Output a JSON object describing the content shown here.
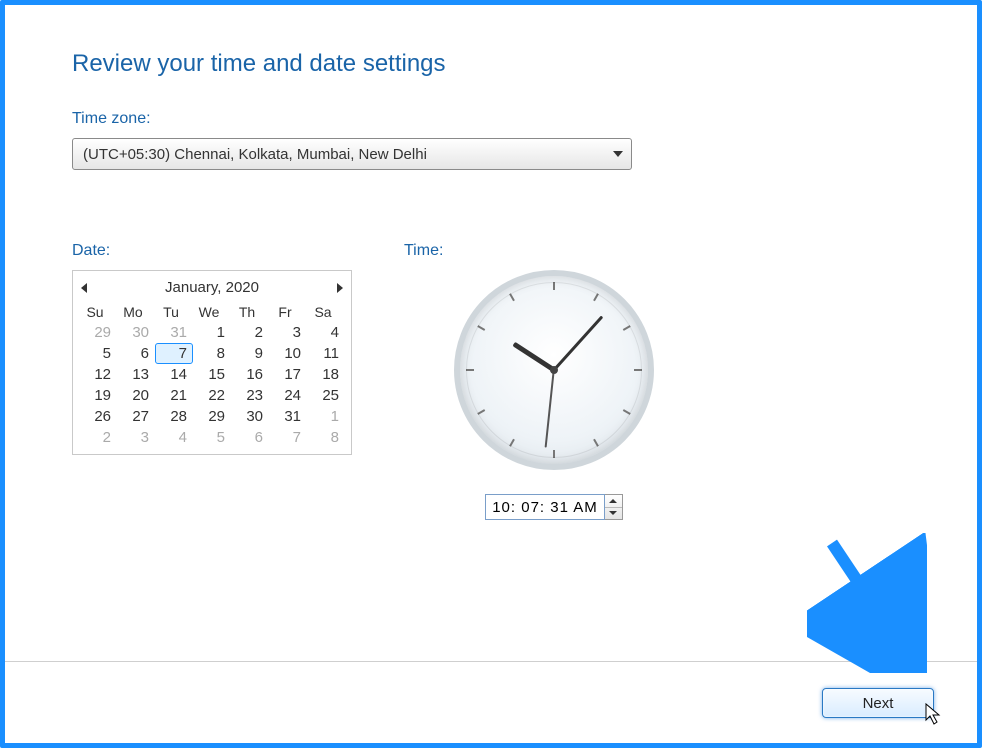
{
  "title": "Review your time and date settings",
  "labels": {
    "timezone": "Time zone:",
    "date": "Date:",
    "time": "Time:"
  },
  "timezone": {
    "selected": "(UTC+05:30) Chennai, Kolkata, Mumbai, New Delhi"
  },
  "calendar": {
    "month_label": "January, 2020",
    "dow": [
      "Su",
      "Mo",
      "Tu",
      "We",
      "Th",
      "Fr",
      "Sa"
    ],
    "weeks": [
      [
        {
          "d": "29",
          "other": true
        },
        {
          "d": "30",
          "other": true
        },
        {
          "d": "31",
          "other": true
        },
        {
          "d": "1"
        },
        {
          "d": "2"
        },
        {
          "d": "3"
        },
        {
          "d": "4"
        }
      ],
      [
        {
          "d": "5"
        },
        {
          "d": "6"
        },
        {
          "d": "7",
          "selected": true
        },
        {
          "d": "8"
        },
        {
          "d": "9"
        },
        {
          "d": "10"
        },
        {
          "d": "11"
        }
      ],
      [
        {
          "d": "12"
        },
        {
          "d": "13"
        },
        {
          "d": "14"
        },
        {
          "d": "15"
        },
        {
          "d": "16"
        },
        {
          "d": "17"
        },
        {
          "d": "18"
        }
      ],
      [
        {
          "d": "19"
        },
        {
          "d": "20"
        },
        {
          "d": "21"
        },
        {
          "d": "22"
        },
        {
          "d": "23"
        },
        {
          "d": "24"
        },
        {
          "d": "25"
        }
      ],
      [
        {
          "d": "26"
        },
        {
          "d": "27"
        },
        {
          "d": "28"
        },
        {
          "d": "29"
        },
        {
          "d": "30"
        },
        {
          "d": "31"
        },
        {
          "d": "1",
          "other": true
        }
      ],
      [
        {
          "d": "2",
          "other": true
        },
        {
          "d": "3",
          "other": true
        },
        {
          "d": "4",
          "other": true
        },
        {
          "d": "5",
          "other": true
        },
        {
          "d": "6",
          "other": true
        },
        {
          "d": "7",
          "other": true
        },
        {
          "d": "8",
          "other": true
        }
      ]
    ]
  },
  "time": {
    "display": "10: 07: 31 AM",
    "hour": 10,
    "minute": 7,
    "second": 31
  },
  "buttons": {
    "next": "Next"
  }
}
